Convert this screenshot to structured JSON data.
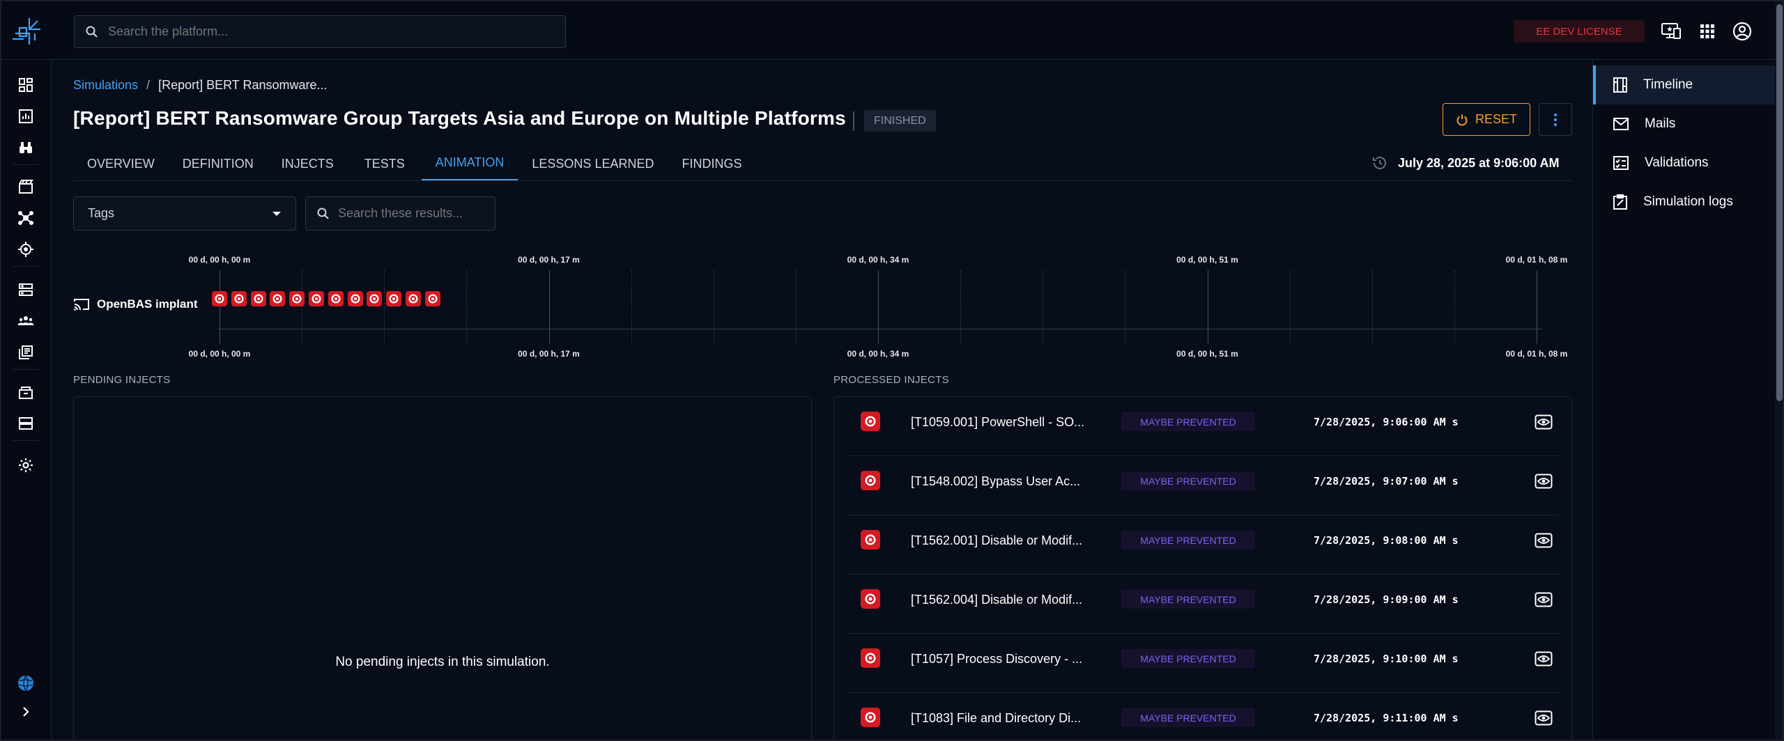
{
  "topbar": {
    "search_placeholder": "Search the platform...",
    "license_label": "EE DEV LICENSE"
  },
  "breadcrumb": {
    "root": "Simulations",
    "separator": "/",
    "current": "[Report] BERT Ransomware..."
  },
  "header": {
    "title": "[Report] BERT Ransomware Group Targets Asia and Europe on Multiple Platforms",
    "status": "FINISHED",
    "reset_label": "RESET",
    "date": "July 28, 2025 at 9:06:00 AM"
  },
  "tabs": [
    {
      "label": "OVERVIEW"
    },
    {
      "label": "DEFINITION"
    },
    {
      "label": "INJECTS"
    },
    {
      "label": "TESTS"
    },
    {
      "label": "ANIMATION",
      "active": true
    },
    {
      "label": "LESSONS LEARNED"
    },
    {
      "label": "FINDINGS"
    }
  ],
  "filters": {
    "tags_label": "Tags",
    "search_placeholder": "Search these results..."
  },
  "timeline": {
    "lane_label": "OpenBAS implant",
    "ticks": [
      "00 d, 00 h, 00 m",
      "00 d, 00 h, 17 m",
      "00 d, 00 h, 34 m",
      "00 d, 00 h, 51 m",
      "00 d, 01 h, 08 m"
    ],
    "inject_minutes": [
      0,
      1,
      2,
      3,
      4,
      5,
      6,
      7,
      8,
      9,
      10,
      11
    ]
  },
  "pending": {
    "title": "PENDING INJECTS",
    "empty_message": "No pending injects in this simulation."
  },
  "processed": {
    "title": "PROCESSED INJECTS",
    "rows": [
      {
        "name": "[T1059.001] PowerShell - SO...",
        "status": "MAYBE PREVENTED",
        "time": "7/28/2025, 9:06:00 AM s"
      },
      {
        "name": "[T1548.002] Bypass User Ac...",
        "status": "MAYBE PREVENTED",
        "time": "7/28/2025, 9:07:00 AM s"
      },
      {
        "name": "[T1562.001] Disable or Modif...",
        "status": "MAYBE PREVENTED",
        "time": "7/28/2025, 9:08:00 AM s"
      },
      {
        "name": "[T1562.004] Disable or Modif...",
        "status": "MAYBE PREVENTED",
        "time": "7/28/2025, 9:09:00 AM s"
      },
      {
        "name": "[T1057] Process Discovery - ...",
        "status": "MAYBE PREVENTED",
        "time": "7/28/2025, 9:10:00 AM s"
      },
      {
        "name": "[T1083] File and Directory Di...",
        "status": "MAYBE PREVENTED",
        "time": "7/28/2025, 9:11:00 AM s"
      }
    ]
  },
  "rightnav": [
    {
      "label": "Timeline",
      "icon": "timeline-icon",
      "active": true
    },
    {
      "label": "Mails",
      "icon": "mail-icon"
    },
    {
      "label": "Validations",
      "icon": "validations-icon"
    },
    {
      "label": "Simulation logs",
      "icon": "simulation-logs-icon"
    }
  ],
  "colors": {
    "accent": "#45a2f0",
    "reset": "#f59f2d",
    "license": "#e8343d",
    "inject": "#d41b24",
    "status_text": "#7c62ee",
    "background": "#070d19"
  }
}
